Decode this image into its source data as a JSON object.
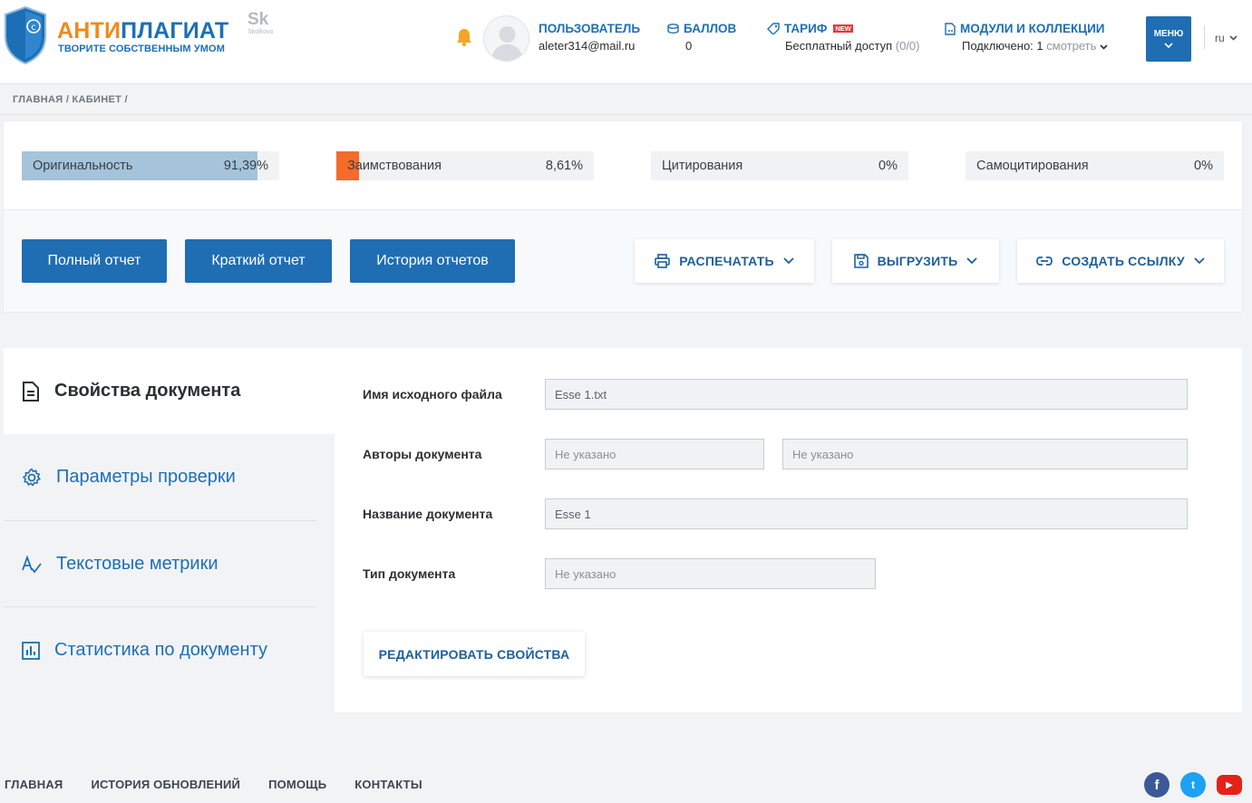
{
  "header": {
    "logo_part1": "АНТИ",
    "logo_part2": "ПЛАГИАТ",
    "tagline": "ТВОРИТЕ СОБСТВЕННЫМ УМОМ",
    "skolkovo_mark": "Sk",
    "skolkovo_text": "Skolkovo",
    "user_label": "ПОЛЬЗОВАТЕЛЬ",
    "user_email": "aleter314@mail.ru",
    "points_label": "БАЛЛОВ",
    "points_value": "0",
    "tariff_label": "ТАРИФ",
    "tariff_badge": "NEW",
    "tariff_value": "Бесплатный доступ",
    "tariff_count": "(0/0)",
    "modules_label": "МОДУЛИ И КОЛЛЕКЦИИ",
    "modules_value": "Подключено: 1",
    "modules_link": "смотреть",
    "menu_label": "МЕНЮ",
    "language": "ru"
  },
  "breadcrumb": "ГЛАВНАЯ / КАБИНЕТ /",
  "stats": [
    {
      "label": "Оригинальность",
      "value": "91,39%",
      "fraction": 0.9139,
      "color": "#a5c3da"
    },
    {
      "label": "Заимствования",
      "value": "8,61%",
      "fraction": 0.0861,
      "color": "#f56b2a"
    },
    {
      "label": "Цитирования",
      "value": "0%",
      "fraction": 0,
      "color": "#f1f2f4"
    },
    {
      "label": "Самоцитирования",
      "value": "0%",
      "fraction": 0,
      "color": "#f1f2f4"
    }
  ],
  "actions": {
    "full_report": "Полный отчет",
    "short_report": "Краткий отчет",
    "history": "История отчетов",
    "print": "РАСПЕЧАТАТЬ",
    "export": "ВЫГРУЗИТЬ",
    "link": "СОЗДАТЬ ССЫЛКУ"
  },
  "sidebar": {
    "items": [
      {
        "label": "Свойства документа",
        "icon": "document-icon"
      },
      {
        "label": "Параметры проверки",
        "icon": "gear-icon"
      },
      {
        "label": "Текстовые метрики",
        "icon": "text-metrics-icon"
      },
      {
        "label": "Статистика по документу",
        "icon": "bar-chart-icon"
      }
    ]
  },
  "properties": {
    "filename_label": "Имя исходного файла",
    "filename_value": "Esse 1.txt",
    "authors_label": "Авторы документа",
    "author1_value": "Не указано",
    "author2_value": "Не указано",
    "title_label": "Название документа",
    "title_value": "Esse 1",
    "type_label": "Тип документа",
    "type_value": "Не указано",
    "edit_button": "РЕДАКТИРОВАТЬ СВОЙСТВА"
  },
  "footer": {
    "links": [
      "ГЛАВНАЯ",
      "ИСТОРИЯ ОБНОВЛЕНИЙ",
      "ПОМОЩЬ",
      "КОНТАКТЫ"
    ],
    "social": [
      {
        "name": "facebook-icon",
        "glyph": "f",
        "color": "#3b5998"
      },
      {
        "name": "twitter-icon",
        "glyph": "t",
        "color": "#1da1f2"
      },
      {
        "name": "youtube-icon",
        "glyph": "▶",
        "color": "#e62117"
      }
    ]
  }
}
